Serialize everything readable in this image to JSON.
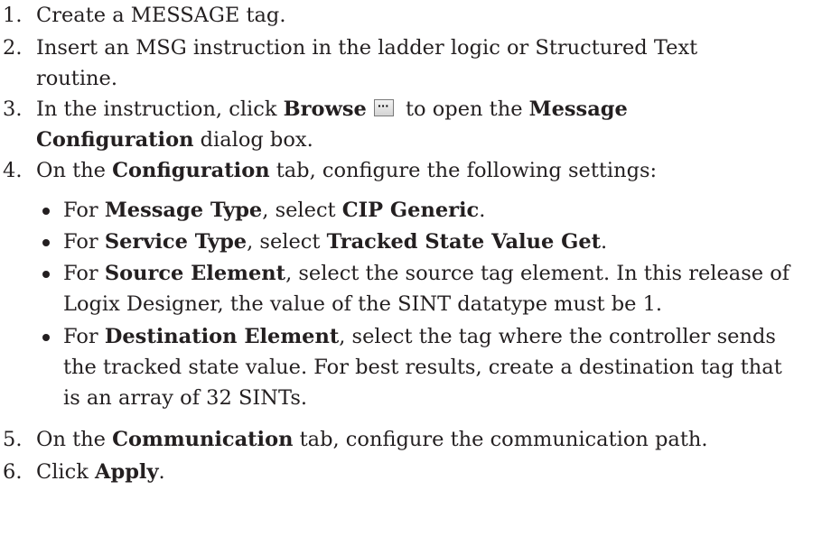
{
  "steps": [
    {
      "num": "1.",
      "text": "Create a MESSAGE tag."
    },
    {
      "num": "2.",
      "line1": "Insert an MSG instruction in the ladder logic or Structured Text",
      "line2": "routine."
    },
    {
      "num": "3.",
      "pre": "In the instruction, click ",
      "bold1": "Browse",
      "mid": " to open the ",
      "bold2": "Message",
      "bold3": "Configuration",
      "post": " dialog box."
    },
    {
      "num": "4.",
      "pre": "On the ",
      "bold": "Configuration",
      "post": " tab, configure the following settings:"
    },
    {
      "num": "5.",
      "pre": "On the ",
      "bold": "Communication",
      "post": " tab, configure the communication path."
    },
    {
      "num": "6.",
      "pre": "Click ",
      "bold": "Apply",
      "post": "."
    }
  ],
  "bullets": [
    {
      "pre": "For ",
      "bold1": "Message Type",
      "mid": ", select ",
      "bold2": "CIP Generic",
      "post": "."
    },
    {
      "pre": "For ",
      "bold1": "Service Type",
      "mid": ", select ",
      "bold2": "Tracked State Value Get",
      "post": "."
    },
    {
      "pre": "For ",
      "bold": "Source Element",
      "post": ", select the source tag element. In this release of",
      "line2": "Logix Designer, the value of the SINT datatype must be 1."
    },
    {
      "pre": "For ",
      "bold": "Destination Element",
      "post": ", select the tag where the controller sends",
      "line2": "the tracked state value. For best results, create a destination tag that",
      "line3": "is an array of 32 SINTs."
    }
  ],
  "icons": {
    "browse": "ellipsis-button-icon"
  }
}
